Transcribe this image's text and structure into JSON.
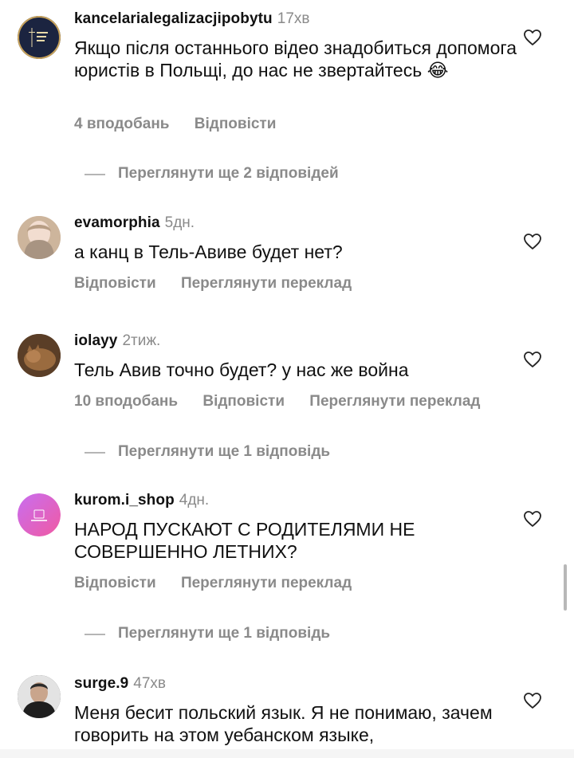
{
  "comments": [
    {
      "username": "kancelarialegalizacjipobytu",
      "time": "17хв",
      "text": "Якщо після останнього відео знадобиться допомога юристів в Польщі, до нас не звертайтесь 😂",
      "likes": "4 вподобань",
      "reply": "Відповісти",
      "view_replies": "Переглянути ще 2 відповідей",
      "avatar_icon": "law-firm-logo-icon"
    },
    {
      "username": "evamorphia",
      "time": "5дн.",
      "text": "а канц в Тель-Авиве будет нет?",
      "reply": "Відповісти",
      "translate": "Переглянути переклад",
      "avatar_icon": "user-photo-icon"
    },
    {
      "username": "iolayy",
      "time": "2тиж.",
      "text": "Тель Авив точно будет? у нас же война",
      "likes": "10 вподобань",
      "reply": "Відповісти",
      "translate": "Переглянути переклад",
      "view_replies": "Переглянути ще 1 відповідь",
      "avatar_icon": "cat-photo-icon"
    },
    {
      "username": "kurom.i_shop",
      "time": "4дн.",
      "text": "НАРОД ПУСКАЮТ С РОДИТЕЛЯМИ НЕ СОВЕРШЕННО ЛЕТНИХ?",
      "reply": "Відповісти",
      "translate": "Переглянути переклад",
      "view_replies": "Переглянути ще 1 відповідь",
      "avatar_icon": "shop-logo-icon"
    },
    {
      "username": "surge.9",
      "time": "47хв",
      "text": "Меня бесит польский язык. Я не понимаю, зачем говорить на этом уебанском языке,",
      "avatar_icon": "user-photo-icon"
    }
  ],
  "colors": {
    "secondary_text": "#8a8a8a",
    "primary_text": "#111111",
    "background": "#ffffff"
  }
}
